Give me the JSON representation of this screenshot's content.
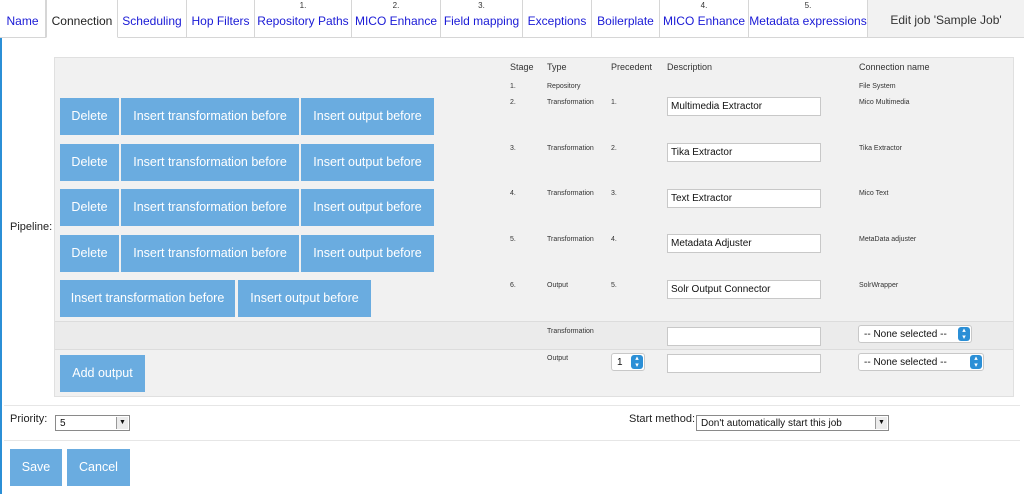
{
  "tabs": [
    {
      "seq": "",
      "label": "Name"
    },
    {
      "seq": "",
      "label": "Connection",
      "active": true
    },
    {
      "seq": "",
      "label": "Scheduling"
    },
    {
      "seq": "",
      "label": "Hop Filters"
    },
    {
      "seq": "1.",
      "label": "Repository Paths"
    },
    {
      "seq": "2.",
      "label": "MICO Enhance"
    },
    {
      "seq": "3.",
      "label": "Field mapping"
    },
    {
      "seq": "",
      "label": "Exceptions"
    },
    {
      "seq": "",
      "label": "Boilerplate"
    },
    {
      "seq": "4.",
      "label": "MICO Enhance"
    },
    {
      "seq": "5.",
      "label": "Metadata expressions"
    }
  ],
  "page_title": "Edit job 'Sample Job'",
  "pipeline": {
    "label": "Pipeline:",
    "headers": {
      "stage": "Stage",
      "type": "Type",
      "precedent": "Precedent",
      "description": "Description",
      "connection": "Connection name"
    },
    "rows": [
      {
        "stage": "1.",
        "type": "Repository",
        "precedent": "",
        "description": "",
        "connection": "File System"
      },
      {
        "stage": "2.",
        "type": "Transformation",
        "precedent": "1.",
        "description": "Multimedia Extractor",
        "connection": "Mico Multimedia"
      },
      {
        "stage": "3.",
        "type": "Transformation",
        "precedent": "2.",
        "description": "Tika Extractor",
        "connection": "Tika Extractor"
      },
      {
        "stage": "4.",
        "type": "Transformation",
        "precedent": "3.",
        "description": "Text Extractor",
        "connection": "Mico Text"
      },
      {
        "stage": "5.",
        "type": "Transformation",
        "precedent": "4.",
        "description": "Metadata Adjuster",
        "connection": "MetaData adjuster"
      },
      {
        "stage": "6.",
        "type": "Output",
        "precedent": "5.",
        "description": "Solr Output Connector",
        "connection": "SolrWrapper"
      }
    ],
    "buttons": {
      "delete": "Delete",
      "insert_transformation_before": "Insert transformation before",
      "insert_output_before": "Insert output before",
      "add_output": "Add output"
    },
    "new_transformation": {
      "type": "Transformation",
      "description": "",
      "connection": "-- None selected --"
    },
    "new_output": {
      "type": "Output",
      "precedent": "1",
      "description": "",
      "connection": "-- None selected --"
    }
  },
  "priority": {
    "label": "Priority:",
    "value": "5"
  },
  "start_method": {
    "label": "Start method:",
    "value": "Don't automatically start this job"
  },
  "actions": {
    "save": "Save",
    "cancel": "Cancel"
  },
  "colors": {
    "button": "#6aace0",
    "tab_link": "#1a1ad6",
    "accent": "#2b8fd6"
  }
}
